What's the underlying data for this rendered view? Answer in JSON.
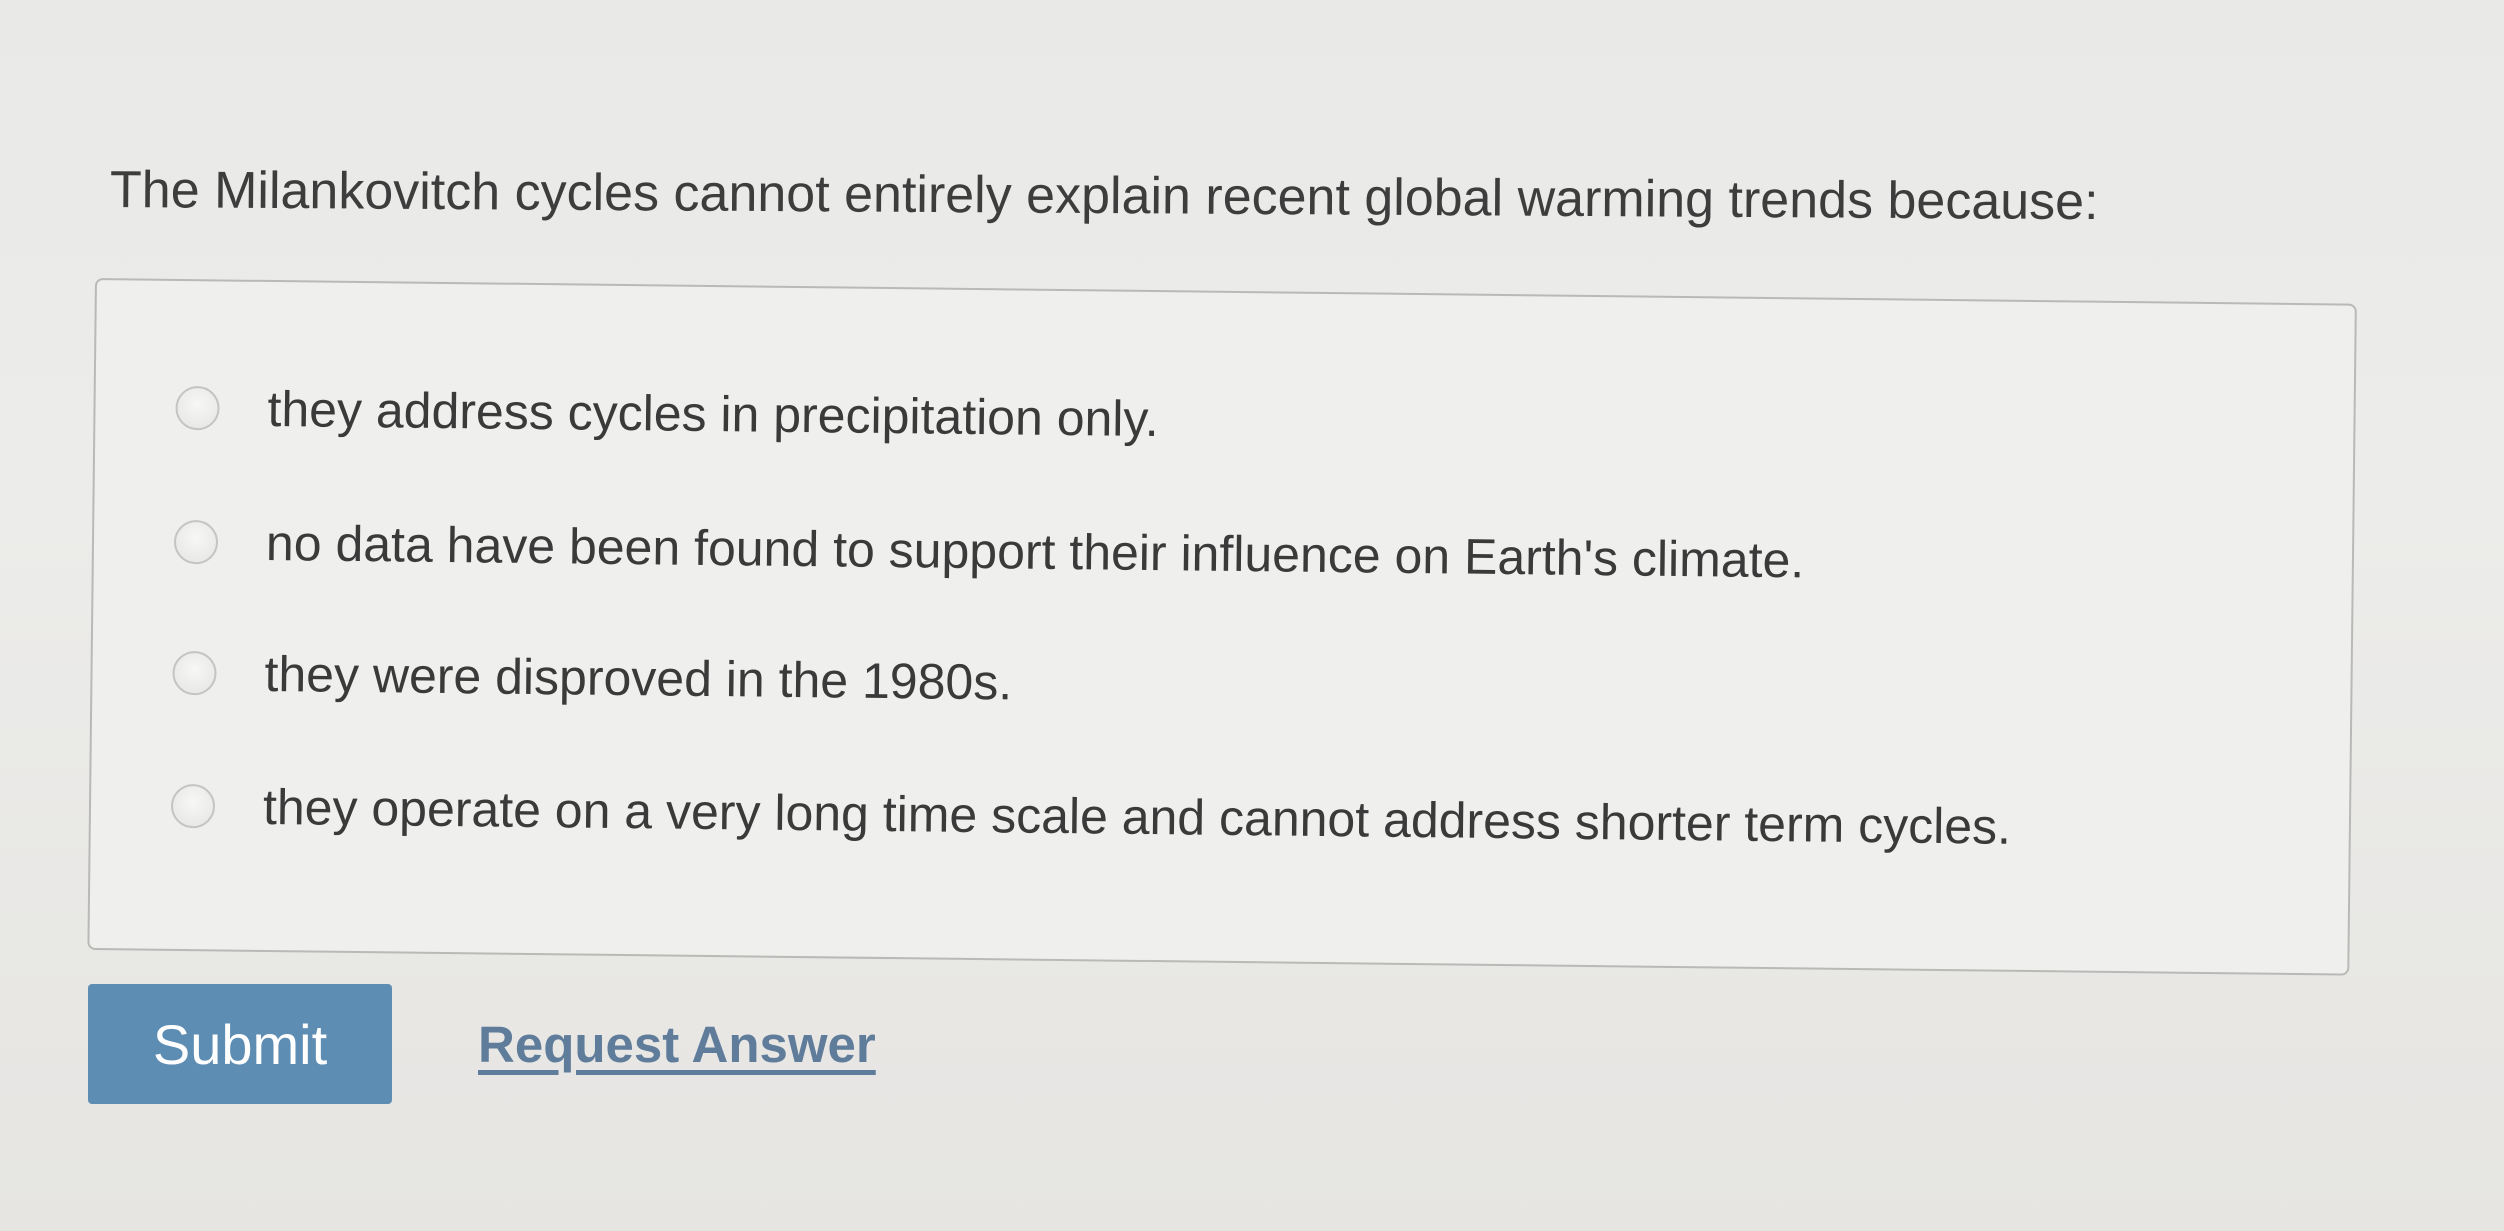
{
  "question": {
    "text": "The Milankovitch cycles cannot entirely explain recent global warming trends because:"
  },
  "options": [
    {
      "label": "they address cycles in precipitation only.",
      "selected": false
    },
    {
      "label": "no data have been found to support their influence on Earth's climate.",
      "selected": false
    },
    {
      "label": "they were disproved in the 1980s.",
      "selected": false
    },
    {
      "label": "they operate on a very long time scale and cannot address shorter term cycles.",
      "selected": false
    }
  ],
  "actions": {
    "submit_label": "Submit",
    "request_answer_label": "Request Answer"
  },
  "colors": {
    "submit_background": "#5e8db4",
    "link": "#5f7c9b"
  }
}
